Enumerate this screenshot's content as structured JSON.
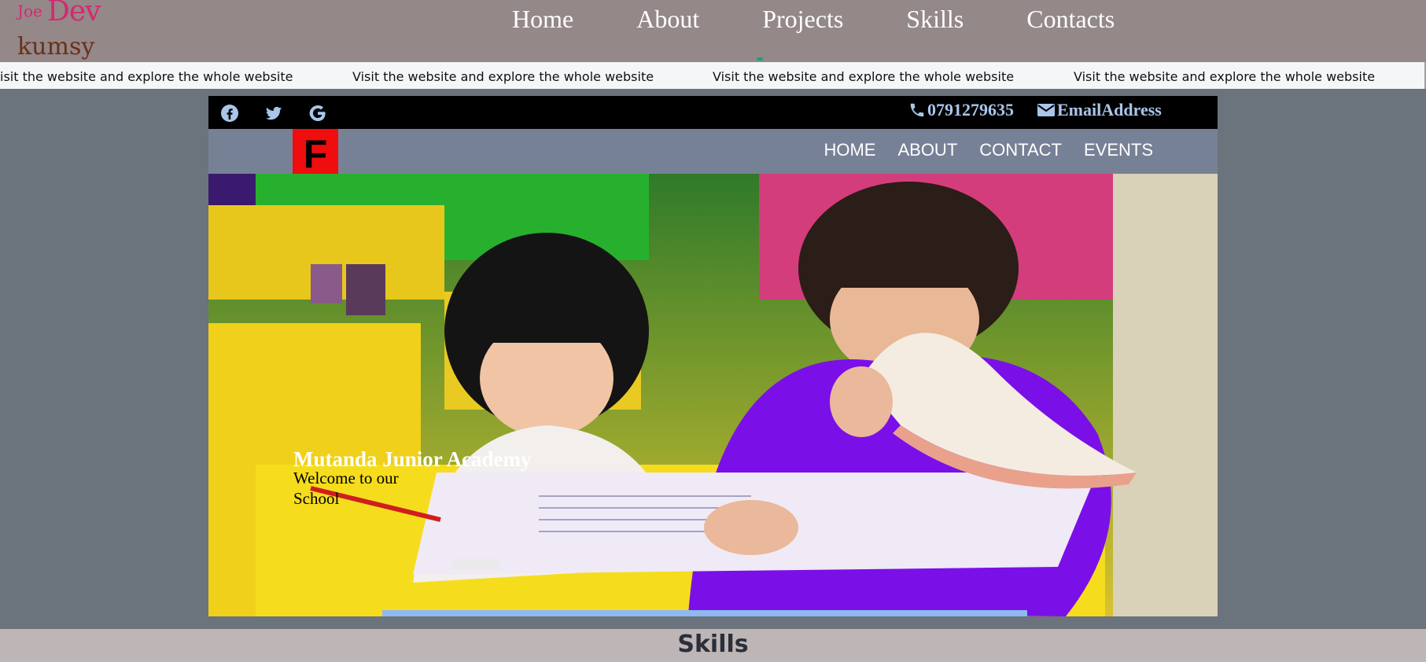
{
  "logo": {
    "part1": "Joe",
    "part2": "Dev",
    "part3": "kumsy"
  },
  "nav": [
    "Home",
    "About",
    "Projects",
    "Skills",
    "Contacts"
  ],
  "marquee": {
    "items": [
      "isit the website and explore the whole website",
      "Visit the website and explore the whole website",
      "Visit the website and explore the whole website",
      "Visit the website and explore the whole website"
    ]
  },
  "site": {
    "social_icons": [
      "facebook-icon",
      "twitter-icon",
      "google-icon"
    ],
    "phone": "0791279635",
    "email": "EmailAddress",
    "logo_letter": "F",
    "nav": [
      "HOME",
      "ABOUT",
      "CONTACT",
      "EVENTS"
    ],
    "hero": {
      "title": "Mutanda Junior Academy",
      "subtitle": "Welcome to our School"
    }
  },
  "section": {
    "title": "Skills"
  },
  "colors": {
    "topbar": "#948889",
    "logo_pink": "#d6286f",
    "logo_brown": "#6b2f18",
    "page_bg": "#6b737d",
    "site_nav": "#778196",
    "site_logo": "#ef0d0d",
    "contact_text": "#a9c6ea",
    "skills_strip": "#bdb5b6"
  }
}
